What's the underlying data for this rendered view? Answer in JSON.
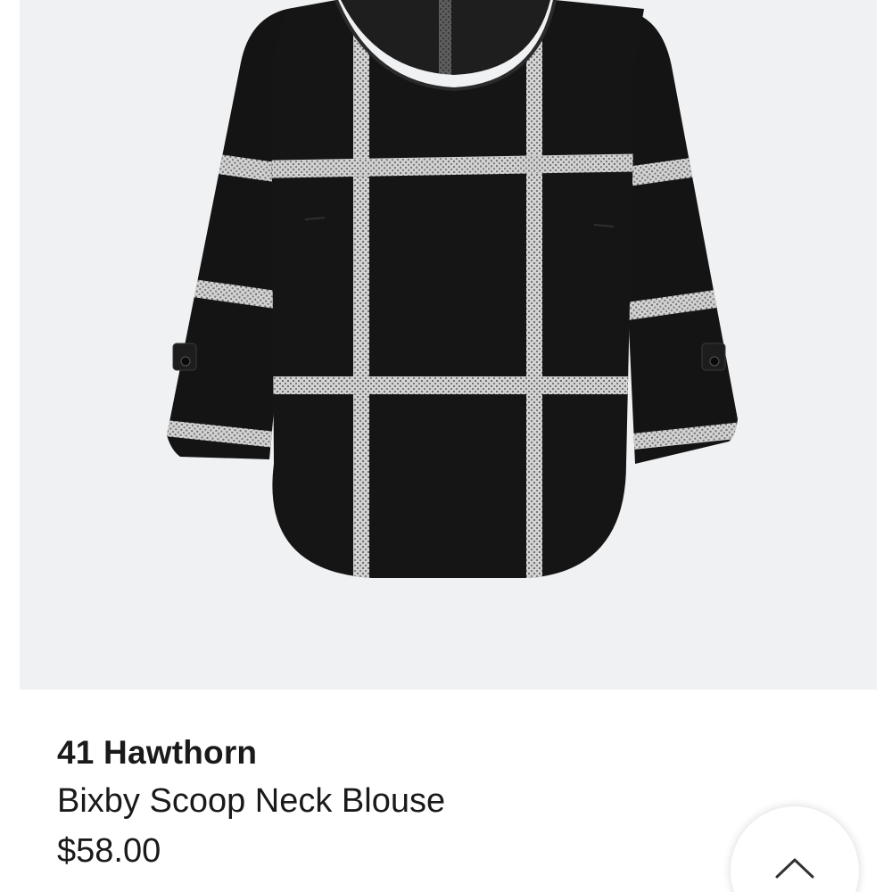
{
  "product": {
    "brand": "41 Hawthorn",
    "name": "Bixby Scoop Neck Blouse",
    "price": "$58.00",
    "image_icon": "product-photo-black-windowpane-blouse"
  },
  "scroll_top": {
    "icon": "chevron-up-icon"
  },
  "colors": {
    "image_background": "#f0f1f3",
    "text": "#1a1a1a",
    "blouse": "#141414",
    "grid_stripe": "#c9c9c9"
  }
}
